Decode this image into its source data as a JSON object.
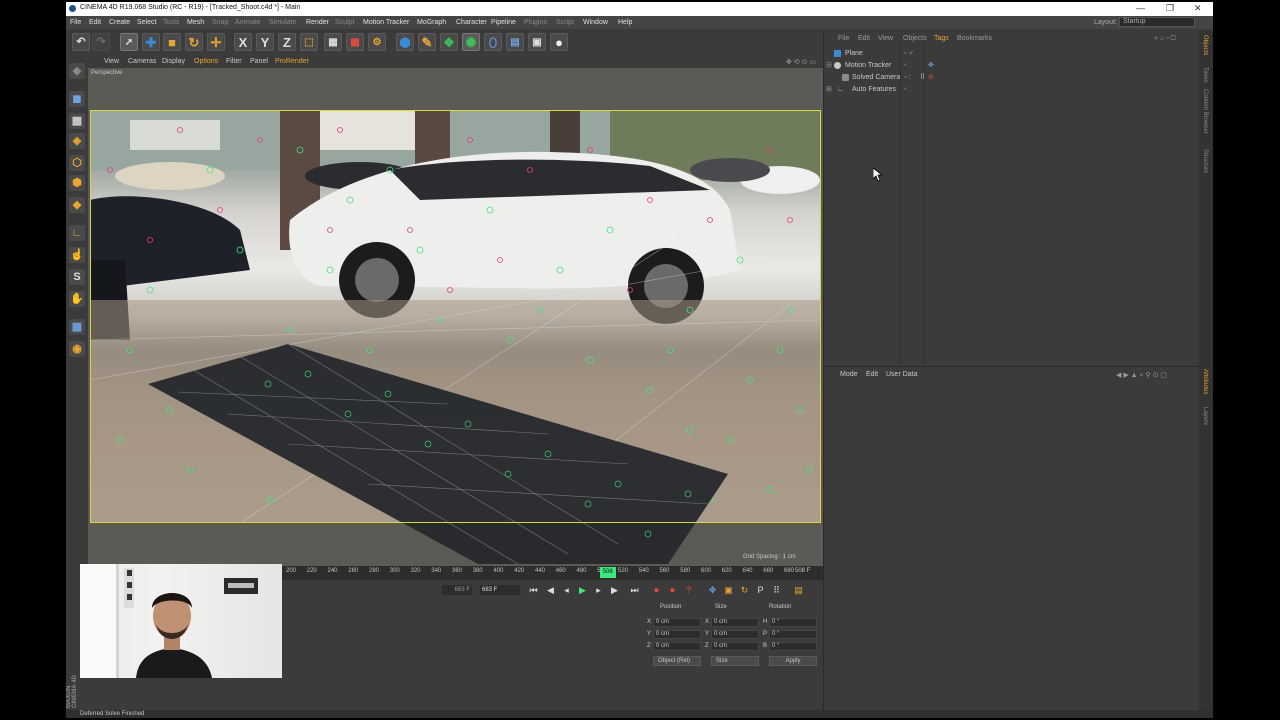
{
  "window": {
    "title": "CINEMA 4D R19.068 Studio (RC - R19) - [Tracked_Shoot.c4d *] - Main",
    "controls": [
      "—",
      "❐",
      "✕"
    ]
  },
  "menubar": {
    "items": [
      "File",
      "Edit",
      "Create",
      "Select",
      "Tools",
      "Mesh",
      "Snap",
      "Animate",
      "Simulate",
      "Render",
      "Sculpt",
      "Motion Tracker",
      "MoGraph",
      "Character",
      "Pipeline",
      "Plugins",
      "Script",
      "Window",
      "Help"
    ],
    "dim_items": [
      "Tools",
      "Snap",
      "Animate",
      "Simulate",
      "Sculpt",
      "Plugins",
      "Script"
    ],
    "layout_label": "Layout:",
    "layout_value": "Startup"
  },
  "toolbar": {
    "axis_x": "X",
    "axis_y": "Y",
    "axis_z": "Z"
  },
  "viewport": {
    "menu": [
      "View",
      "Cameras",
      "Display",
      "Options",
      "Filter",
      "Panel",
      "ProRender"
    ],
    "highlighted_menu": [
      "Options",
      "ProRender"
    ],
    "label": "Perspective",
    "grid_spacing": "Grid Spacing : 1 cm"
  },
  "timeline": {
    "ticks": [
      "200",
      "220",
      "240",
      "260",
      "280",
      "300",
      "320",
      "340",
      "360",
      "380",
      "400",
      "420",
      "440",
      "460",
      "480",
      "500",
      "520",
      "540",
      "560",
      "580",
      "600",
      "620",
      "640",
      "660",
      "680"
    ],
    "current_frame": "508",
    "end_label": "508 F",
    "field_1": "683 F",
    "field_2": "683 F",
    "playhead_fraction": 0.63
  },
  "coords": {
    "headers": [
      "Position",
      "Size",
      "Rotation"
    ],
    "rows": [
      {
        "axis": "X",
        "pos": "0 cm",
        "size_axis": "X",
        "size": "0 cm",
        "rot_axis": "H",
        "rot": "0 °"
      },
      {
        "axis": "Y",
        "pos": "0 cm",
        "size_axis": "Y",
        "size": "0 cm",
        "rot_axis": "P",
        "rot": "0 °"
      },
      {
        "axis": "Z",
        "pos": "0 cm",
        "size_axis": "Z",
        "size": "0 cm",
        "rot_axis": "B",
        "rot": "0 °"
      }
    ],
    "mode_select": "Object (Rel)",
    "size_select": "Size",
    "apply": "Apply"
  },
  "object_manager": {
    "menu": [
      "File",
      "Edit",
      "View",
      "Objects",
      "Tags",
      "Bookmarks"
    ],
    "objects": [
      {
        "name": "Plane",
        "indent": 0
      },
      {
        "name": "Motion Tracker",
        "indent": 0
      },
      {
        "name": "Solved Camera",
        "indent": 1
      },
      {
        "name": "Auto Features",
        "indent": 1
      }
    ]
  },
  "attribute_manager": {
    "menu": [
      "Mode",
      "Edit",
      "User Data"
    ]
  },
  "side_tabs": [
    "Objects",
    "Takes",
    "Content Browser",
    "Structure",
    "Attributes",
    "Layers"
  ],
  "status": {
    "text": "Deferred Solve Finished"
  },
  "brand": {
    "logo_text": "MAXON CINEMA 4D"
  },
  "colors": {
    "ui_bg": "#3b3b3b",
    "accent_orange": "#e8a532",
    "track_green": "#3ee87a",
    "track_magenta": "#e4407a",
    "selection_yellow": "#d8d840"
  }
}
